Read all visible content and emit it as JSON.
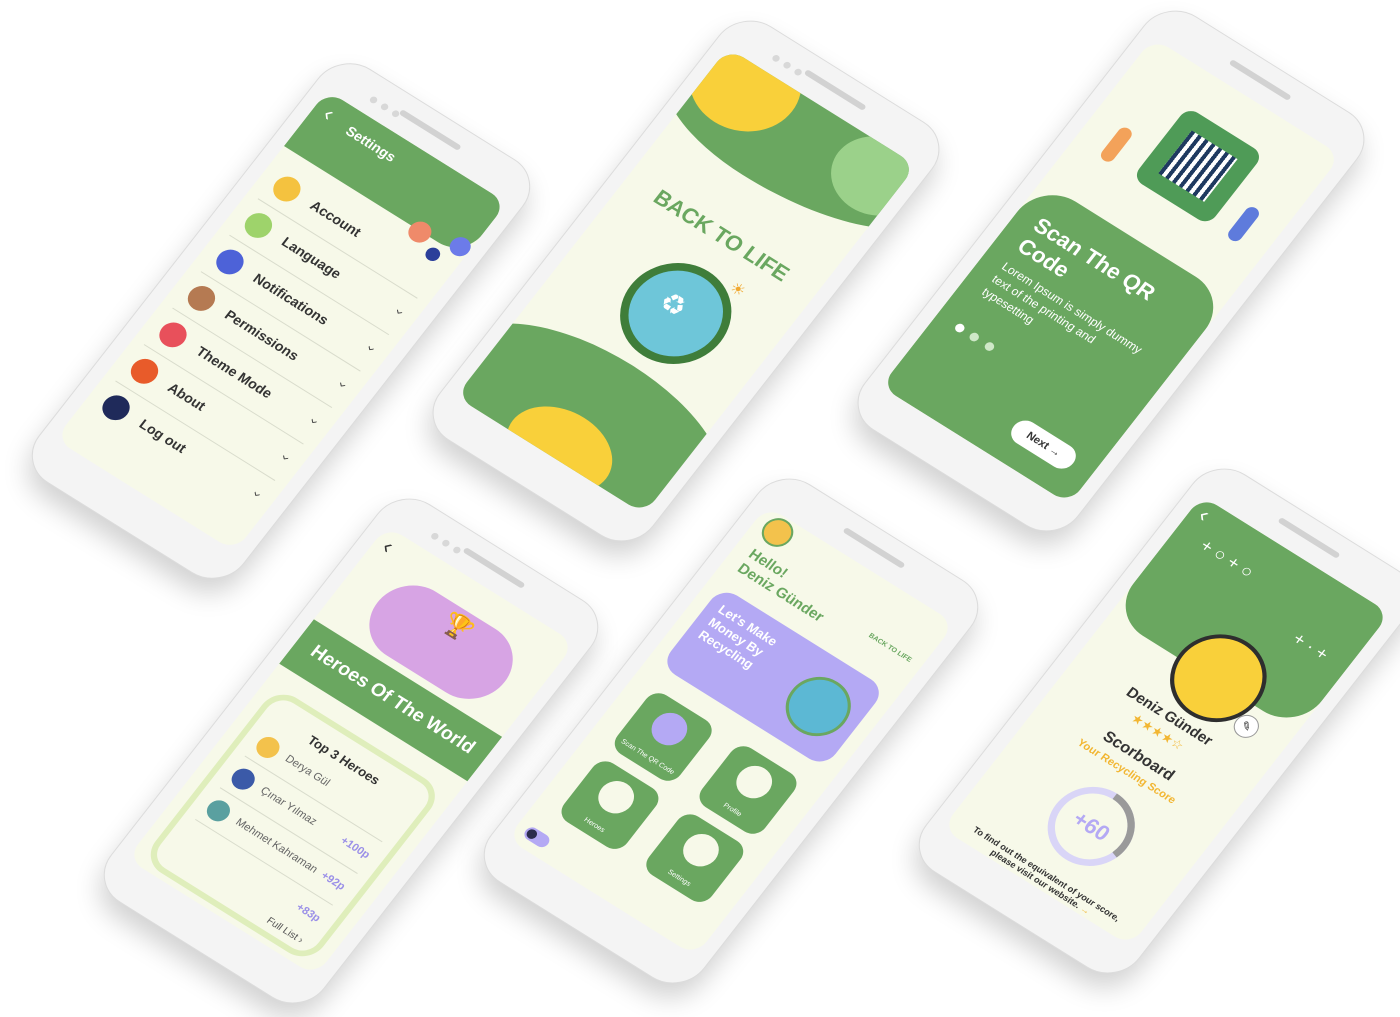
{
  "settings": {
    "back": "‹",
    "title": "Settings",
    "items": [
      "Account",
      "Language",
      "Notifications",
      "Permissions",
      "Theme Mode",
      "About",
      "Log out"
    ],
    "chevron": "›"
  },
  "splash": {
    "title": "BACK TO LIFE"
  },
  "onboarding": {
    "title": "Scan The QR Code",
    "body": "Lorem Ipsum is simply dummy text of the printing and typesetting",
    "next_label": "Next",
    "next_arrow": "→"
  },
  "heroes": {
    "back": "‹",
    "title": "Heroes Of The World",
    "list_title": "Top 3 Heroes",
    "rows": [
      {
        "name": "Derya Gül",
        "score": ""
      },
      {
        "name": "Çınar Yılmaz",
        "score": "+100p"
      },
      {
        "name": "Mehmet Kahraman",
        "score": "+92p"
      },
      {
        "name": "",
        "score": "+83p"
      }
    ],
    "full_list": "Full List ›"
  },
  "home": {
    "greeting": "Hello!",
    "username": "Deniz Günder",
    "brand": "BACK TO LIFE",
    "promo": "Let's Make Money By Recycling",
    "tiles": [
      "Scan The QR Code",
      "Heroes",
      "Profile",
      "Settings"
    ]
  },
  "profile": {
    "back": "‹",
    "name": "Deniz Günder",
    "stars": "★★★★☆",
    "section": "Scorboard",
    "subtitle": "Your Recycling Score",
    "score": "+60",
    "score_fraction": 0.3,
    "footer": "To find out the equivalent of your score, please visit our website.",
    "footer_arrow": "→"
  },
  "colors": {
    "green": "#6aa760",
    "light_green": "#9bd18a",
    "yellow": "#f9d03a",
    "cream": "#f7f9e9",
    "lavender": "#b4a9f4"
  }
}
